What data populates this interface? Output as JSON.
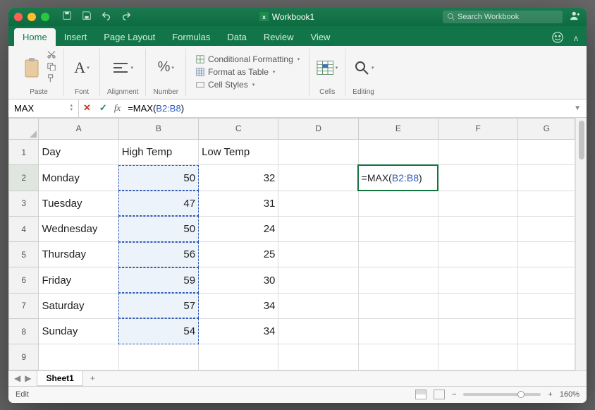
{
  "titlebar": {
    "workbook": "Workbook1",
    "search_placeholder": "Search Workbook"
  },
  "tabs": {
    "items": [
      "Home",
      "Insert",
      "Page Layout",
      "Formulas",
      "Data",
      "Review",
      "View"
    ],
    "active": 0
  },
  "ribbon": {
    "paste": "Paste",
    "font": "Font",
    "alignment": "Alignment",
    "number": "Number",
    "cf": "Conditional Formatting",
    "fat": "Format as Table",
    "cs": "Cell Styles",
    "cells": "Cells",
    "editing": "Editing"
  },
  "namebox": {
    "ref": "MAX"
  },
  "formula": {
    "prefix": "=MAX(",
    "range": "B2:B8",
    "suffix": ")"
  },
  "columns": [
    "A",
    "B",
    "C",
    "D",
    "E",
    "F",
    "G"
  ],
  "rows": [
    "1",
    "2",
    "3",
    "4",
    "5",
    "6",
    "7",
    "8",
    "9"
  ],
  "grid": {
    "A1": "Day",
    "B1": "High Temp",
    "C1": "Low Temp",
    "A2": "Monday",
    "B2": "50",
    "C2": "32",
    "A3": "Tuesday",
    "B3": "47",
    "C3": "31",
    "A4": "Wednesday",
    "B4": "50",
    "C4": "24",
    "A5": "Thursday",
    "B5": "56",
    "C5": "25",
    "A6": "Friday",
    "B6": "59",
    "C6": "30",
    "A7": "Saturday",
    "B7": "57",
    "C7": "34",
    "A8": "Sunday",
    "B8": "54",
    "C8": "34"
  },
  "active_cell": "E2",
  "cell_formula": {
    "prefix": "=MAX(",
    "range": "B2:B8",
    "suffix": ")"
  },
  "sheet_tabs": {
    "sheets": [
      "Sheet1"
    ],
    "active": 0
  },
  "status": {
    "mode": "Edit",
    "zoom": "160%"
  },
  "chart_data": {
    "type": "table",
    "columns": [
      "Day",
      "High Temp",
      "Low Temp"
    ],
    "rows": [
      [
        "Monday",
        50,
        32
      ],
      [
        "Tuesday",
        47,
        31
      ],
      [
        "Wednesday",
        50,
        24
      ],
      [
        "Thursday",
        56,
        25
      ],
      [
        "Friday",
        59,
        30
      ],
      [
        "Saturday",
        57,
        34
      ],
      [
        "Sunday",
        54,
        34
      ]
    ]
  }
}
